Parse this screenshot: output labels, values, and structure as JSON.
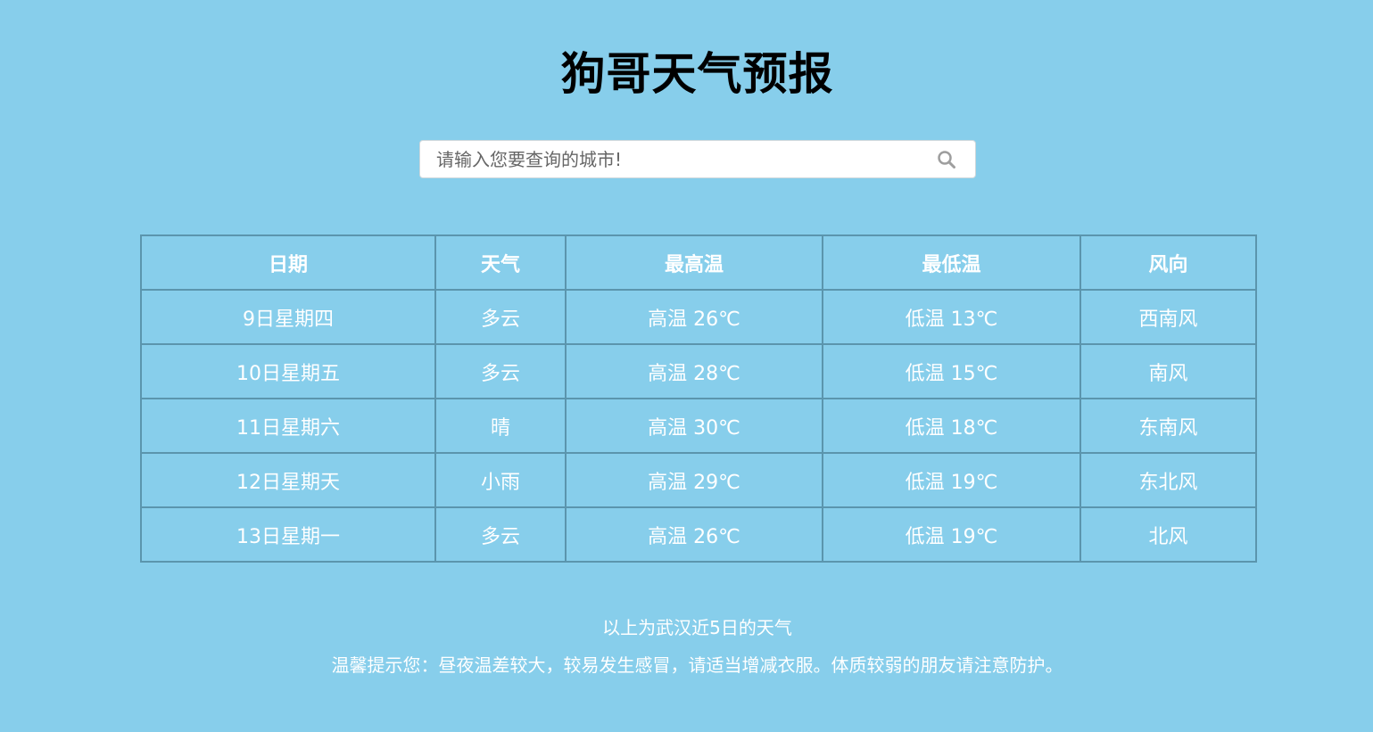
{
  "title": "狗哥天气预报",
  "search": {
    "placeholder": "请输入您要查询的城市!"
  },
  "table": {
    "headers": [
      "日期",
      "天气",
      "最高温",
      "最低温",
      "风向"
    ],
    "rows": [
      [
        "9日星期四",
        "多云",
        "高温 26℃",
        "低温 13℃",
        "西南风"
      ],
      [
        "10日星期五",
        "多云",
        "高温 28℃",
        "低温 15℃",
        "南风"
      ],
      [
        "11日星期六",
        "晴",
        "高温 30℃",
        "低温 18℃",
        "东南风"
      ],
      [
        "12日星期天",
        "小雨",
        "高温 29℃",
        "低温 19℃",
        "东北风"
      ],
      [
        "13日星期一",
        "多云",
        "高温 26℃",
        "低温 19℃",
        "北风"
      ]
    ]
  },
  "footer": {
    "summary": "以上为武汉近5日的天气",
    "tip": "温馨提示您：昼夜温差较大，较易发生感冒，请适当增减衣服。体质较弱的朋友请注意防护。"
  },
  "colors": {
    "background": "#87ceeb",
    "table_border": "#5b95ad",
    "text": "#ffffff"
  },
  "icons": {
    "search": "search-icon"
  }
}
